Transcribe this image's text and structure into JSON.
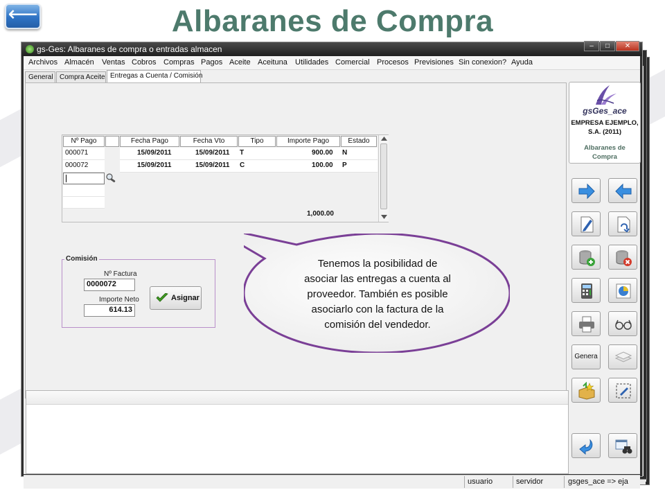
{
  "slide": {
    "title": "Albaranes de Compra",
    "back_symbol": "⟵"
  },
  "window": {
    "title": "gs-Ges: Albaranes de compra o entradas almacen",
    "controls": {
      "minimize": "–",
      "maximize": "□",
      "close": "✕"
    }
  },
  "menu": [
    "Archivos",
    "Almacén",
    "Ventas",
    "Cobros",
    "Compras",
    "Pagos",
    "Aceite",
    "Aceituna",
    "Utilidades",
    "Comercial",
    "Procesos",
    "Previsiones",
    "Sin conexion?",
    "Ayuda"
  ],
  "tabs": [
    {
      "label": "General",
      "active": false
    },
    {
      "label": "Compra Aceite",
      "active": false
    },
    {
      "label": "Entregas a Cuenta / Comisión",
      "active": true
    }
  ],
  "payments_table": {
    "columns": [
      "Nº Pago",
      "",
      "Fecha Pago",
      "Fecha Vto",
      "Tipo",
      "Importe Pago",
      "Estado"
    ],
    "rows": [
      [
        "000071",
        "",
        "15/09/2011",
        "15/09/2011",
        "T",
        "900.00",
        "N"
      ],
      [
        "000072",
        "",
        "15/09/2011",
        "15/09/2011",
        "C",
        "100.00",
        "P"
      ]
    ],
    "total": "1,000.00"
  },
  "commission": {
    "title": "Comisión",
    "invoice_label": "Nº Factura",
    "invoice_value": "0000072",
    "net_label": "Importe Neto",
    "net_value": "614.13",
    "assign_label": "Asignar"
  },
  "callout": {
    "lines": [
      "Tenemos la posibilidad de",
      "asociar las entregas a cuenta al",
      "proveedor. También es posible",
      "asociarlo con la factura de la",
      "comisión del vendedor."
    ]
  },
  "sidebar": {
    "logo_name": "gsGes_ace",
    "company_lines": [
      "EMPRESA EJEMPLO,",
      "S.A. (2011)"
    ],
    "module_lines": [
      "Albaranes de",
      "Compra"
    ],
    "genera_label": "Genera"
  },
  "status": {
    "user": "usuario",
    "server": "servidor",
    "db": "gsges_ace => eja"
  },
  "colors": {
    "title_green": "#4d7a6c",
    "callout_border": "#7a3f96",
    "group_border": "#b98fc9"
  }
}
